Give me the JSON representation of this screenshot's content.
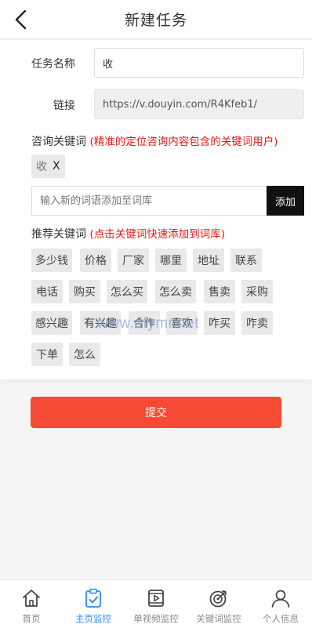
{
  "header": {
    "title": "新建任务"
  },
  "form": {
    "task_name_label": "任务名称",
    "task_name_value": "收",
    "link_label": "链接",
    "link_value": "https://v.douyin.com/R4Kfeb1/"
  },
  "consult": {
    "title": "咨询关键词",
    "hint": "(精准的定位咨询内容包含的关键词用户)",
    "selected_keywords": [
      {
        "label": "收",
        "remove": "X"
      }
    ],
    "input_placeholder": "输入新的词语添加至词库",
    "add_button": "添加"
  },
  "recommend": {
    "title": "推荐关键词",
    "hint": "(点击关键词快速添加到词库)",
    "tags": [
      "多少钱",
      "价格",
      "厂家",
      "哪里",
      "地址",
      "联系",
      "电话",
      "购买",
      "怎么买",
      "怎么卖",
      "售卖",
      "采购",
      "感兴趣",
      "有兴趣",
      "合作",
      "喜欢",
      "咋买",
      "咋卖",
      "下单",
      "怎么"
    ]
  },
  "watermark": "www.dfymr.net",
  "submit_label": "提交",
  "tabbar": {
    "items": [
      {
        "label": "首页",
        "icon": "home-icon",
        "active": false
      },
      {
        "label": "主页监控",
        "icon": "clipboard-check-icon",
        "active": true
      },
      {
        "label": "单视频监控",
        "icon": "video-play-icon",
        "active": false
      },
      {
        "label": "关键词监控",
        "icon": "target-icon",
        "active": false
      },
      {
        "label": "个人信息",
        "icon": "user-icon",
        "active": false
      }
    ]
  },
  "colors": {
    "accent": "#2d8cf0",
    "submit": "#f64a34",
    "hint_red": "#e21a1a",
    "add_button_bg": "#111111"
  }
}
